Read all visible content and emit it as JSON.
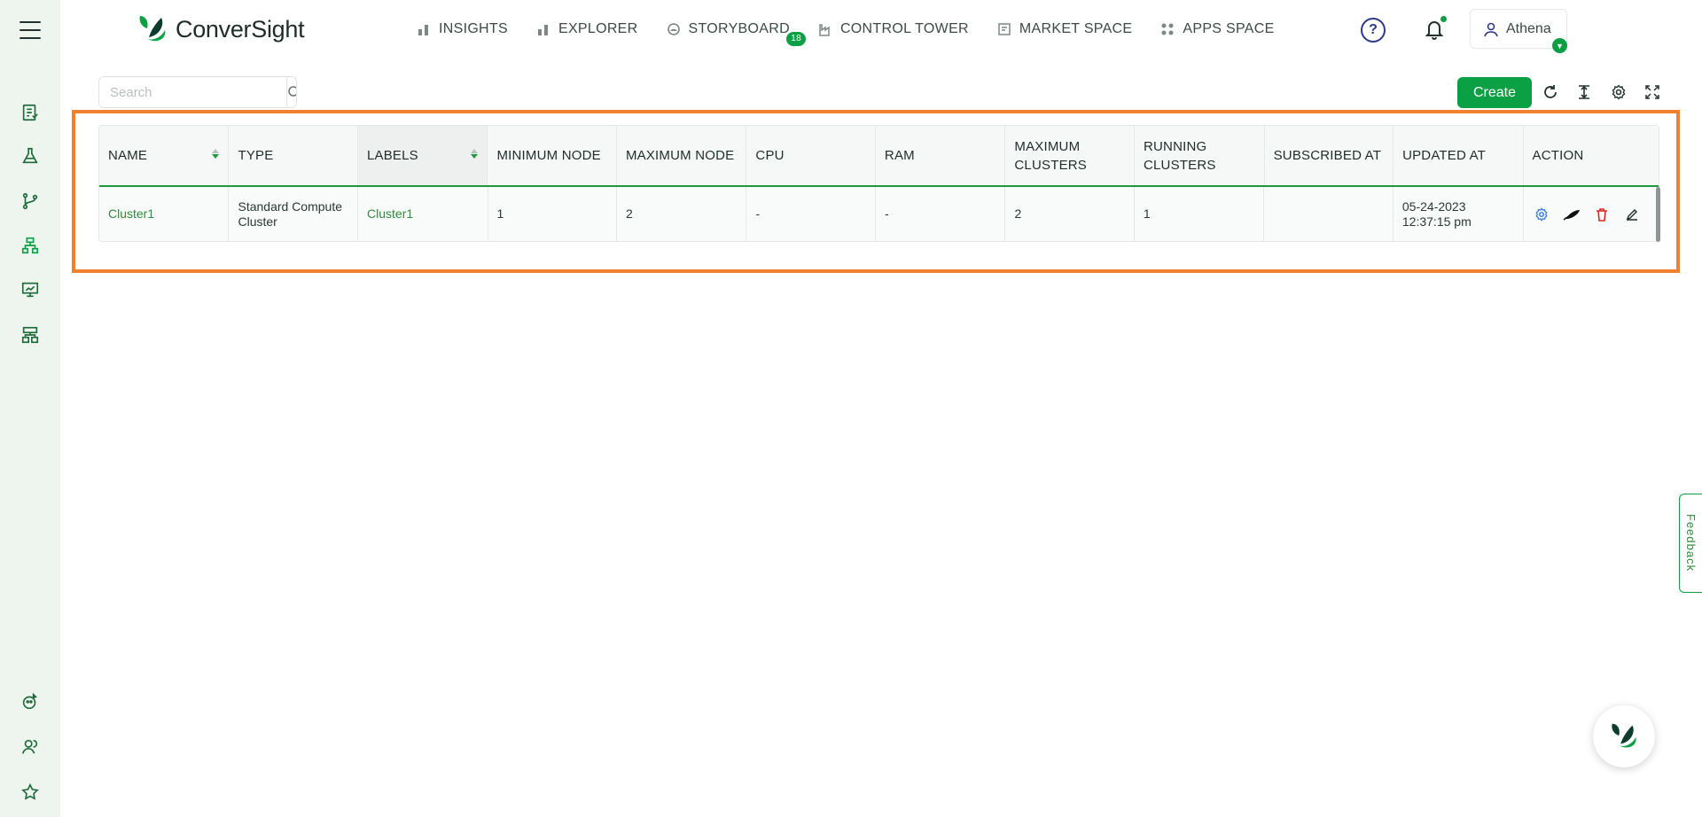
{
  "brand": {
    "name": "ConverSight"
  },
  "nav": {
    "items": [
      {
        "label": "INSIGHTS",
        "icon": "bar-chart-icon"
      },
      {
        "label": "EXPLORER",
        "icon": "bar-chart-icon"
      },
      {
        "label": "STORYBOARD",
        "icon": "storyboard-icon",
        "badge": "18"
      },
      {
        "label": "CONTROL TOWER",
        "icon": "factory-icon"
      },
      {
        "label": "MARKET SPACE",
        "icon": "market-icon"
      },
      {
        "label": "APPS SPACE",
        "icon": "apps-icon"
      }
    ]
  },
  "header": {
    "help_label": "?",
    "user_name": "Athena"
  },
  "toolbar": {
    "search_placeholder": "Search",
    "create_label": "Create"
  },
  "table": {
    "columns": [
      "NAME",
      "TYPE",
      "LABELS",
      "MINIMUM NODE",
      "MAXIMUM NODE",
      "CPU",
      "RAM",
      "MAXIMUM CLUSTERS",
      "RUNNING CLUSTERS",
      "SUBSCRIBED AT",
      "UPDATED AT",
      "ACTION"
    ],
    "rows": [
      {
        "name": "Cluster1",
        "type": "Standard Compute Cluster",
        "labels": "Cluster1",
        "min_node": "1",
        "max_node": "2",
        "cpu": "-",
        "ram": "-",
        "max_clusters": "2",
        "running_clusters": "1",
        "subscribed_at": "",
        "updated_at": "05-24-2023 12:37:15 pm"
      }
    ]
  },
  "feedback_label": "Feedback",
  "colors": {
    "accent": "#0aa043",
    "highlight": "#f0812f",
    "link": "#2e8b3a"
  }
}
